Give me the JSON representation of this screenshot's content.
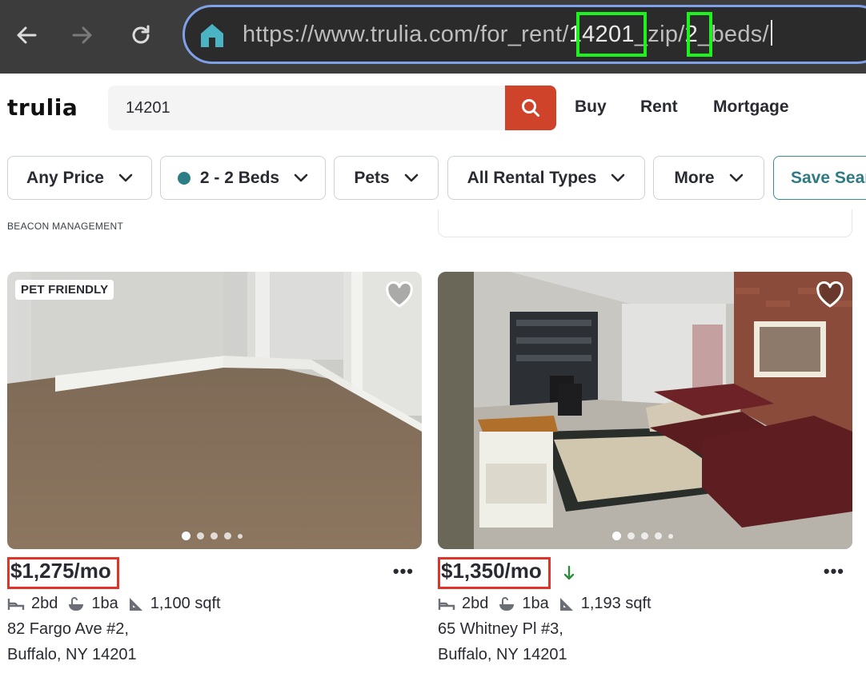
{
  "browser": {
    "url_base": "https://www.trulia.com/for_rent/",
    "url_zip": "14201",
    "url_mid": "_zip/",
    "url_beds": "2",
    "url_end": "_beds/"
  },
  "site": {
    "logo_text": "trulia",
    "search": {
      "value": "14201",
      "placeholder": ""
    },
    "nav": [
      "Buy",
      "Rent",
      "Mortgage"
    ]
  },
  "filters": {
    "price": "Any Price",
    "beds": "2 - 2 Beds",
    "pets": "Pets",
    "rental_types": "All Rental Types",
    "more": "More",
    "save_search": "Save Search"
  },
  "previous_listing": {
    "broker": "BEACON MANAGEMENT"
  },
  "listings": [
    {
      "badge": "PET FRIENDLY",
      "price": "$1,275/mo",
      "price_drop": false,
      "beds": "2bd",
      "baths": "1ba",
      "sqft": "1,100 sqft",
      "street": "82 Fargo Ave #2,",
      "city": "Buffalo, NY 14201",
      "photo_index": 1,
      "photo_count": 5
    },
    {
      "badge": "",
      "price": "$1,350/mo",
      "price_drop": true,
      "beds": "2bd",
      "baths": "1ba",
      "sqft": "1,193 sqft",
      "street": "65 Whitney Pl #3,",
      "city": "Buffalo, NY 14201",
      "photo_index": 1,
      "photo_count": 5
    }
  ],
  "colors": {
    "brand_red": "#d0432b",
    "teal": "#2c7e86",
    "highlight_green": "#1cf21c",
    "highlight_red": "#e0332a",
    "price_drop_green": "#2e8b3e"
  },
  "icons": {
    "back": "arrow-left-icon",
    "forward": "arrow-right-icon",
    "reload": "reload-icon",
    "home": "home-icon",
    "search": "search-icon",
    "heart": "heart-icon",
    "bed": "bed-icon",
    "bath": "bath-icon",
    "area": "ruler-triangle-icon",
    "chevron": "chevron-down-icon",
    "more": "more-horizontal-icon",
    "price_drop": "arrow-down-icon"
  }
}
